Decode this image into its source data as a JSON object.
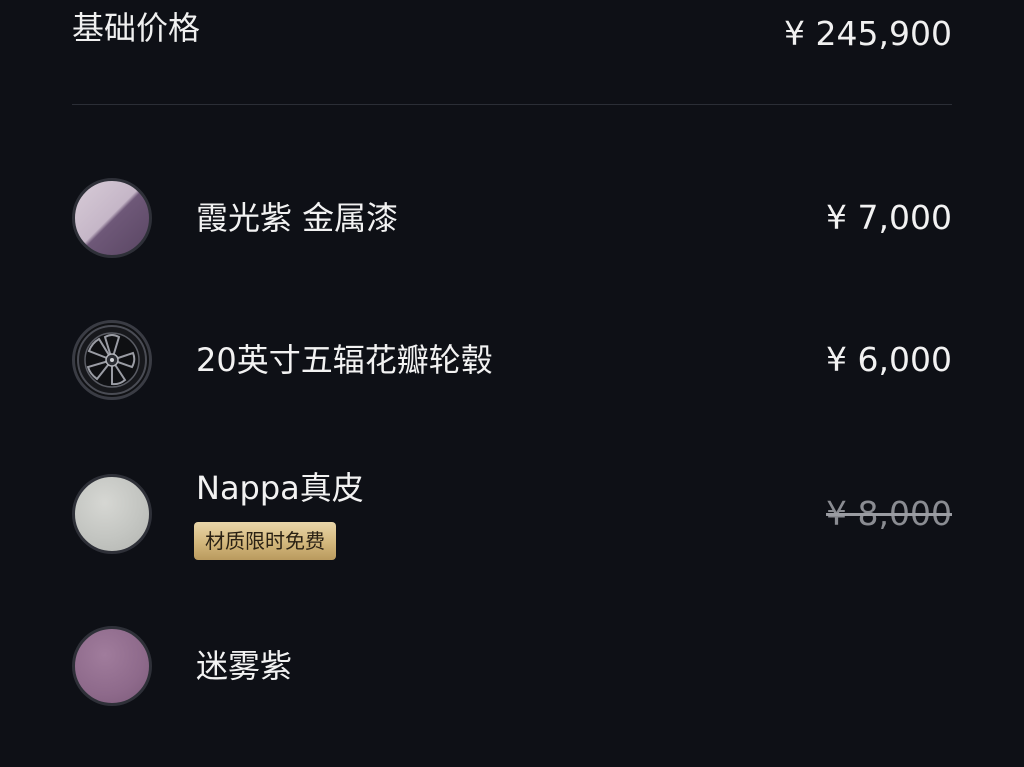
{
  "base": {
    "label": "基础价格",
    "price": "¥ 245,900"
  },
  "options": [
    {
      "name": "霞光紫 金属漆",
      "price": "¥ 7,000",
      "swatch": "paint-swatch"
    },
    {
      "name": "20英寸五辐花瓣轮毂",
      "price": "¥ 6,000",
      "swatch": "wheel-swatch"
    },
    {
      "name": "Nappa真皮",
      "price": "¥ 8,000",
      "price_struck": true,
      "badge": "材质限时免费",
      "swatch": "leather-swatch"
    },
    {
      "name": "迷雾紫",
      "price": "",
      "swatch": "mist-purple-swatch"
    }
  ],
  "colors": {
    "background": "#0e1016",
    "text": "#f2f2f2",
    "struck_price": "#8a8c92",
    "badge_gold": "#d3b77c",
    "divider": "#2b2e36"
  }
}
